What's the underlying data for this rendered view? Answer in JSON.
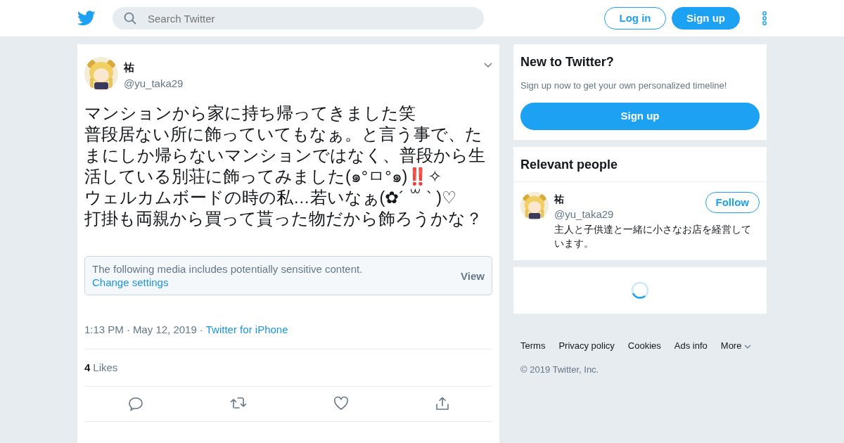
{
  "header": {
    "search": {
      "placeholder": "Search Twitter"
    },
    "buttons": [
      {
        "label": "Log in",
        "kind": "outline"
      },
      {
        "label": "Sign up",
        "kind": "filled"
      }
    ]
  },
  "tweet": {
    "name": "祐",
    "handle": "@yu_taka29",
    "text_lines": [
      "マンションから家に持ち帰ってきました笑",
      "普段居ない所に飾っていてもなぁ。と言う事で、たまにしか帰らないマンションではなく、普段から生活している別荘に飾ってみました(๑°ㅁ°๑)‼️✧",
      "ウェルカムボードの時の私…若いなぁ(✿´ ꒳ ` )♡",
      "打掛も両親から買って貰った物だから飾ろうかな？"
    ],
    "sensitive": {
      "message": "The following media includes potentially sensitive content.",
      "link": "Change settings",
      "action": "View"
    },
    "time": "1:13 PM",
    "separator_1": "·",
    "date": "May 12, 2019",
    "separator_2": "·",
    "source": "Twitter for iPhone",
    "likes_count": "4",
    "likes_label": "Likes"
  },
  "signup_card": {
    "title": "New to Twitter?",
    "subtitle": "Sign up now to get your own personalized timeline!",
    "button": "Sign up"
  },
  "relevant": {
    "title": "Relevant people",
    "people": [
      {
        "name": "祐",
        "handle": "@yu_taka29",
        "bio": "主人と子供達と一緒に小さなお店を経営しています。",
        "button": "Follow"
      }
    ]
  },
  "footer": {
    "links": [
      "Terms",
      "Privacy policy",
      "Cookies",
      "Ads info",
      "More"
    ],
    "copyright": "© 2019 Twitter, Inc."
  }
}
